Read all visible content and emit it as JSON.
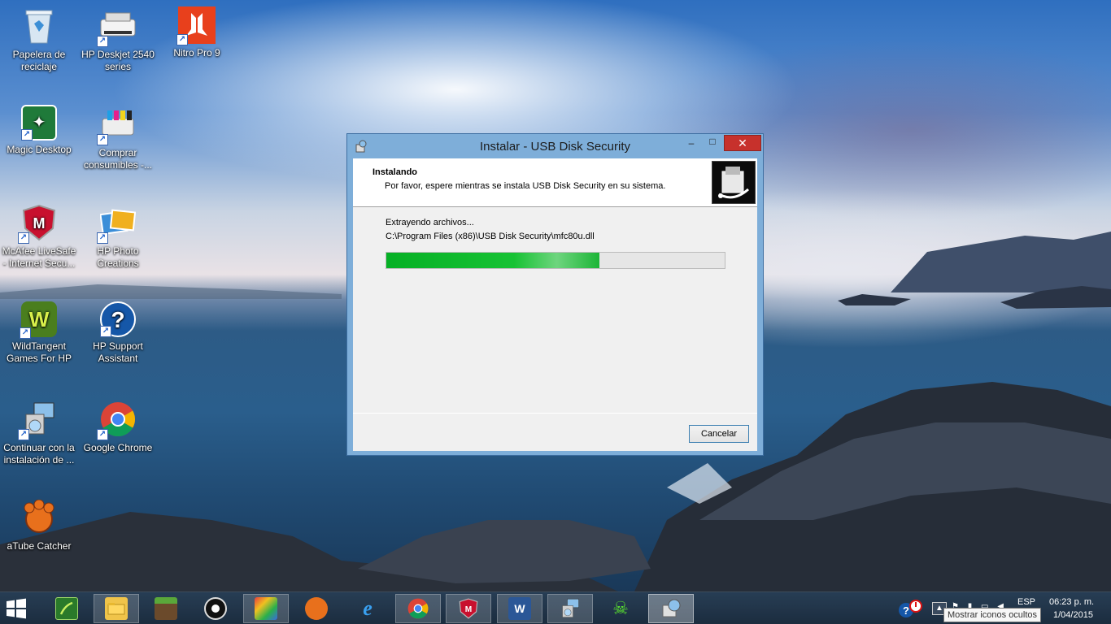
{
  "desktop": {
    "icons": [
      {
        "label_line1": "Papelera de",
        "label_line2": "reciclaje",
        "icon": "recycle-bin-icon"
      },
      {
        "label_line1": "HP Deskjet 2540",
        "label_line2": "series",
        "icon": "printer-icon"
      },
      {
        "label_line1": "Nitro Pro 9",
        "label_line2": "",
        "icon": "nitro-pdf-icon"
      },
      {
        "label_line1": "Magic Desktop",
        "label_line2": "",
        "icon": "magic-desktop-icon"
      },
      {
        "label_line1": "Comprar",
        "label_line2": "consumibles -...",
        "icon": "printer-ink-icon"
      },
      {
        "label_line1": "McAfee LiveSafe",
        "label_line2": "- Internet Secu...",
        "icon": "mcafee-shield-icon"
      },
      {
        "label_line1": "HP Photo",
        "label_line2": "Creations",
        "icon": "photo-creations-icon"
      },
      {
        "label_line1": "WildTangent",
        "label_line2": "Games For HP",
        "icon": "wildtangent-icon"
      },
      {
        "label_line1": "HP Support",
        "label_line2": "Assistant",
        "icon": "help-question-icon"
      },
      {
        "label_line1": "Continuar con la",
        "label_line2": "instalación de ...",
        "icon": "installer-icon"
      },
      {
        "label_line1": "Google Chrome",
        "label_line2": "",
        "icon": "chrome-icon"
      },
      {
        "label_line1": "aTube Catcher",
        "label_line2": "",
        "icon": "atube-catcher-icon"
      }
    ]
  },
  "dialog": {
    "title": "Instalar - USB Disk Security",
    "minimize_glyph": "–",
    "maximize_glyph": "□",
    "close_glyph": "✕",
    "header_title": "Instalando",
    "header_subtitle": "Por favor, espere mientras se instala USB Disk Security en su sistema.",
    "status_text": "Extrayendo archivos...",
    "file_path": "C:\\Program Files (x86)\\USB Disk Security\\mfc80u.dll",
    "progress_fraction": 0.63,
    "cancel_label": "Cancelar"
  },
  "taskbar": {
    "items": [
      {
        "icon": "slingplayer-icon",
        "state": "pinned"
      },
      {
        "icon": "file-explorer-icon",
        "state": "open"
      },
      {
        "icon": "minecraft-icon",
        "state": "pinned"
      },
      {
        "icon": "webcam-icon",
        "state": "pinned"
      },
      {
        "icon": "photo-app-icon",
        "state": "open"
      },
      {
        "icon": "atube-catcher-icon",
        "state": "pinned"
      },
      {
        "icon": "internet-explorer-icon",
        "state": "pinned"
      },
      {
        "icon": "chrome-icon",
        "state": "open"
      },
      {
        "icon": "mcafee-icon",
        "state": "open"
      },
      {
        "icon": "word-icon",
        "state": "open"
      },
      {
        "icon": "installer-icon",
        "state": "open"
      },
      {
        "icon": "game-skull-icon",
        "state": "pinned"
      },
      {
        "icon": "usb-disk-security-icon",
        "state": "active"
      }
    ],
    "tray": {
      "language": "ESP",
      "time": "06:23 p. m.",
      "date": "1/04/2015",
      "tooltip": "Mostrar iconos ocultos"
    }
  },
  "colors": {
    "progress_green": "#06b025",
    "close_red": "#c7312c",
    "window_frame": "#7eaed9"
  }
}
